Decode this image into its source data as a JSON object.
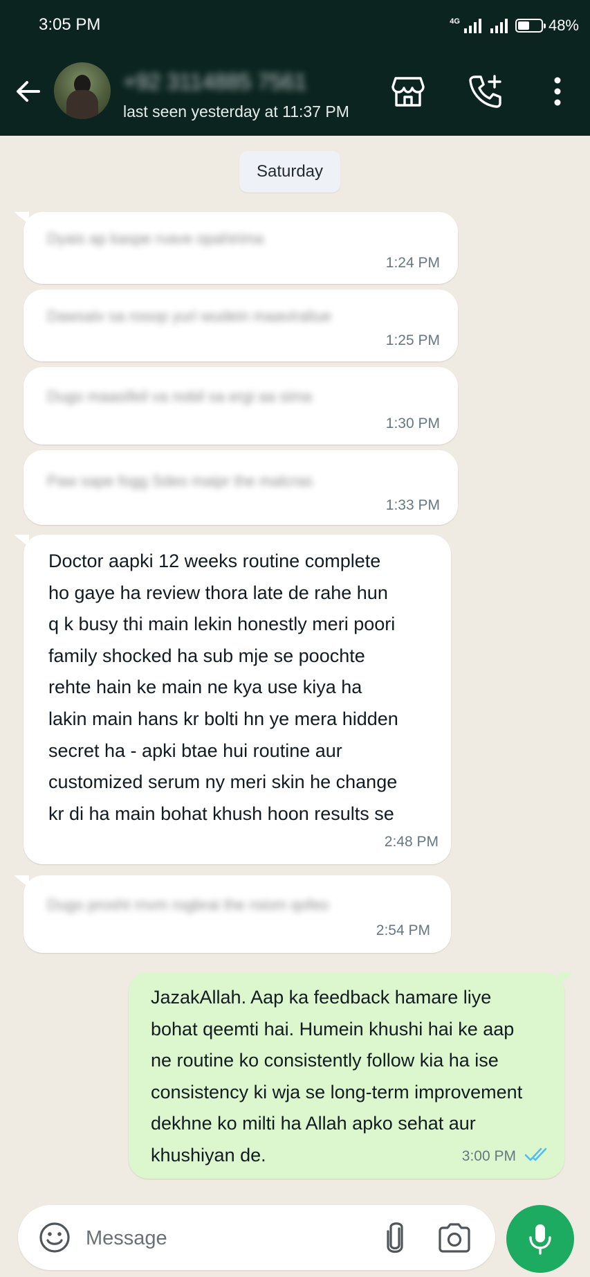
{
  "status_bar": {
    "time": "3:05 PM",
    "network_type": "4G",
    "battery": "48%"
  },
  "header": {
    "contact_name": "+92 3114885 7561",
    "last_seen": "last seen yesterday at 11:37 PM",
    "icons": [
      "back-arrow-icon",
      "store-icon",
      "add-call-icon",
      "more-vertical-icon"
    ]
  },
  "chat": {
    "date_divider": "Saturday",
    "messages": [
      {
        "direction": "in",
        "text": "Dyais ap kaspe rvave opahirima",
        "time": "1:24 PM",
        "redacted": true
      },
      {
        "direction": "in",
        "text": "Dawsaiv sa rooop yuri wudein maaviraliue",
        "time": "1:25 PM",
        "redacted": true
      },
      {
        "direction": "in",
        "text": "Dugo maasifeil va nobil sa ergi aa sima",
        "time": "1:30 PM",
        "redacted": true
      },
      {
        "direction": "in",
        "text": "Paw sape fogg Sdeo maipr the malcras",
        "time": "1:33 PM",
        "redacted": true
      },
      {
        "direction": "in",
        "text": "Doctor aapki 12 weeks routine complete\nho gaye ha review thora late de rahe hun\nq k busy thi main  lekin honestly meri poori\nfamily shocked ha sub mje se poochte\nrehte hain ke main ne kya use kiya ha\nlakin main hans kr bolti hn ye mera hidden\nsecret ha - apki btae hui routine aur\ncustomized serum ny meri skin he change\nkr di ha main bohat khush hoon results se",
        "time": "2:48 PM",
        "redacted": false
      },
      {
        "direction": "in",
        "text": "Dugo prosht rnvm rogbrai the rsiom qofeo",
        "time": "2:54 PM",
        "redacted": true
      },
      {
        "direction": "out",
        "text": "JazakAllah. Aap ka feedback hamare liye\nbohat qeemti hai. Humein khushi hai ke aap\nne routine ko consistently follow kia ha ise\nconsistency ki wja se long-term improvement\ndekhne ko milti ha Allah apko sehat aur\nkhushiyan de.",
        "time": "3:00 PM",
        "status": "read",
        "redacted": false
      }
    ]
  },
  "composer": {
    "placeholder": "Message",
    "icons": [
      "emoji-icon",
      "attachment-icon",
      "camera-icon",
      "microphone-icon"
    ]
  },
  "colors": {
    "header_bg": "#0b2420",
    "chat_bg": "#efeae2",
    "incoming_bubble": "#ffffff",
    "outgoing_bubble": "#dcf7cd",
    "mic_button": "#1daa61",
    "read_tick": "#53bdeb"
  }
}
